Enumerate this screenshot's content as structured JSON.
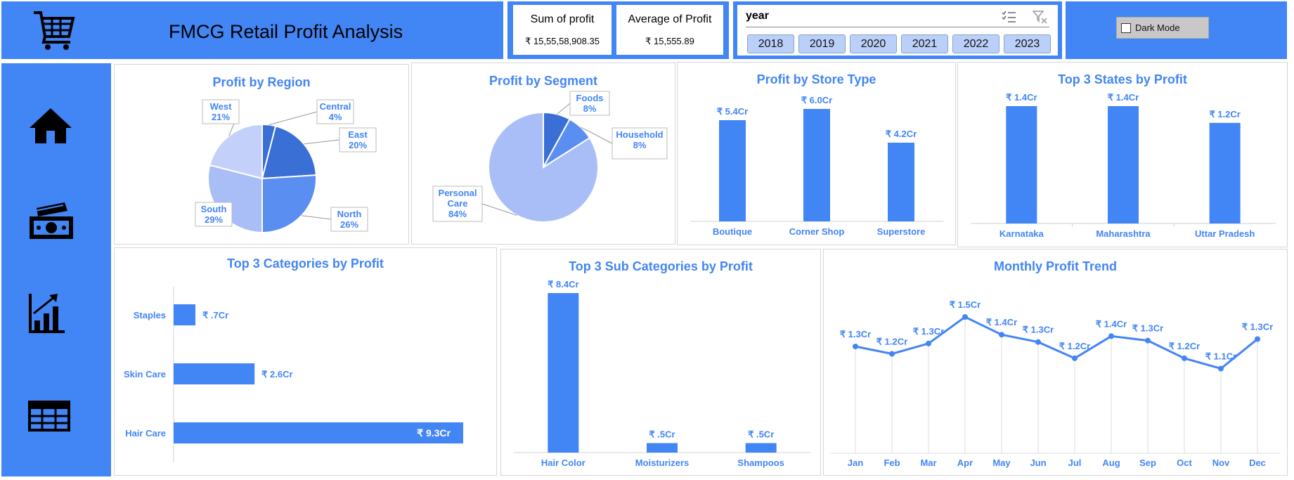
{
  "header": {
    "title": "FMCG Retail Profit Analysis",
    "kpis": [
      {
        "label": "Sum of profit",
        "value": "₹ 15,55,58,908.35"
      },
      {
        "label": "Average of Profit",
        "value": "₹ 15,555.89"
      }
    ],
    "slicer": {
      "title": "year",
      "years": [
        "2018",
        "2019",
        "2020",
        "2021",
        "2022",
        "2023"
      ]
    },
    "dark_mode_label": "Dark Mode"
  },
  "sidebar": {
    "icons": [
      "home-icon",
      "money-icon",
      "chart-icon",
      "table-icon"
    ]
  },
  "colors": {
    "accent": "#4285f4",
    "pie_dark": "#3a6fd6",
    "pie_mid": "#5a8ef0",
    "pie_light": "#a9bef7",
    "pie_lighter": "#c3d0f9"
  },
  "chart_data": [
    {
      "id": "region",
      "type": "pie",
      "title": "Profit by Region",
      "slices": [
        {
          "label": "Central",
          "percent": 4,
          "display": "4%"
        },
        {
          "label": "East",
          "percent": 20,
          "display": "20%"
        },
        {
          "label": "North",
          "percent": 26,
          "display": "26%"
        },
        {
          "label": "South",
          "percent": 29,
          "display": "29%"
        },
        {
          "label": "West",
          "percent": 21,
          "display": "21%"
        }
      ]
    },
    {
      "id": "segment",
      "type": "pie",
      "title": "Profit by Segment",
      "slices": [
        {
          "label": "Foods",
          "percent": 8,
          "display": "8%"
        },
        {
          "label": "Household",
          "percent": 8,
          "display": "8%"
        },
        {
          "label": "Personal Care",
          "percent": 84,
          "display": "84%"
        }
      ]
    },
    {
      "id": "store",
      "type": "bar",
      "title": "Profit by Store Type",
      "categories": [
        "Boutique",
        "Corner Shop",
        "Superstore"
      ],
      "values": [
        5.4,
        6.0,
        4.2
      ],
      "labels": [
        "₹ 5.4Cr",
        "₹ 6.0Cr",
        "₹ 4.2Cr"
      ]
    },
    {
      "id": "states",
      "type": "bar",
      "title": "Top 3 States by Profit",
      "categories": [
        "Karnataka",
        "Maharashtra",
        "Uttar Pradesh"
      ],
      "values": [
        1.4,
        1.4,
        1.2
      ],
      "labels": [
        "₹ 1.4Cr",
        "₹ 1.4Cr",
        "₹ 1.2Cr"
      ]
    },
    {
      "id": "categories",
      "type": "bar",
      "orientation": "horizontal",
      "title": "Top 3 Categories by Profit",
      "categories": [
        "Staples",
        "Skin Care",
        "Hair Care"
      ],
      "values": [
        0.7,
        2.6,
        9.3
      ],
      "labels": [
        "₹ .7Cr",
        "₹ 2.6Cr",
        "₹ 9.3Cr"
      ]
    },
    {
      "id": "subcategories",
      "type": "bar",
      "title": "Top 3 Sub Categories by Profit",
      "categories": [
        "Hair Color",
        "Moisturizers",
        "Shampoos"
      ],
      "values": [
        8.4,
        0.5,
        0.5
      ],
      "labels": [
        "₹ 8.4Cr",
        "₹ .5Cr",
        "₹ .5Cr"
      ]
    },
    {
      "id": "monthly",
      "type": "line",
      "title": "Monthly Profit Trend",
      "categories": [
        "Jan",
        "Feb",
        "Mar",
        "Apr",
        "May",
        "Jun",
        "Jul",
        "Aug",
        "Sep",
        "Oct",
        "Nov",
        "Dec"
      ],
      "values": [
        1.3,
        1.25,
        1.32,
        1.5,
        1.38,
        1.33,
        1.22,
        1.37,
        1.34,
        1.22,
        1.15,
        1.35
      ],
      "labels": [
        "₹ 1.3Cr",
        "₹ 1.2Cr",
        "₹ 1.3Cr",
        "₹ 1.5Cr",
        "₹ 1.4Cr",
        "₹ 1.3Cr",
        "₹ 1.2Cr",
        "₹ 1.4Cr",
        "₹ 1.3Cr",
        "₹ 1.2Cr",
        "₹ 1.1Cr",
        "₹ 1.3Cr"
      ]
    }
  ]
}
